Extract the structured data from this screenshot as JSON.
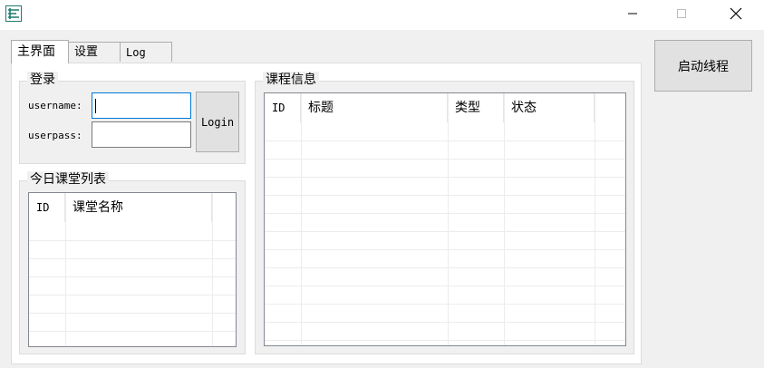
{
  "window": {
    "icon": "app-logo-icon",
    "controls": [
      "minimize-icon",
      "maximize-icon",
      "close-icon"
    ]
  },
  "tabs": [
    {
      "label": "主界面",
      "active": true
    },
    {
      "label": "设置",
      "active": false
    },
    {
      "label": "Log",
      "active": false
    }
  ],
  "login": {
    "group_label": "登录",
    "username_label": "username:",
    "username_value": "",
    "userpass_label": "userpass:",
    "userpass_value": "",
    "login_button": "Login"
  },
  "today_list": {
    "group_label": "今日课堂列表",
    "columns": [
      "ID",
      "课堂名称"
    ],
    "rows": []
  },
  "course_info": {
    "group_label": "课程信息",
    "columns": [
      "ID",
      "标题",
      "类型",
      "状态"
    ],
    "rows": []
  },
  "start_button": "启动线程",
  "colors": {
    "window_bg": "#f0f0f0",
    "focus_border": "#0078d7",
    "button_bg": "#e1e1e1"
  }
}
